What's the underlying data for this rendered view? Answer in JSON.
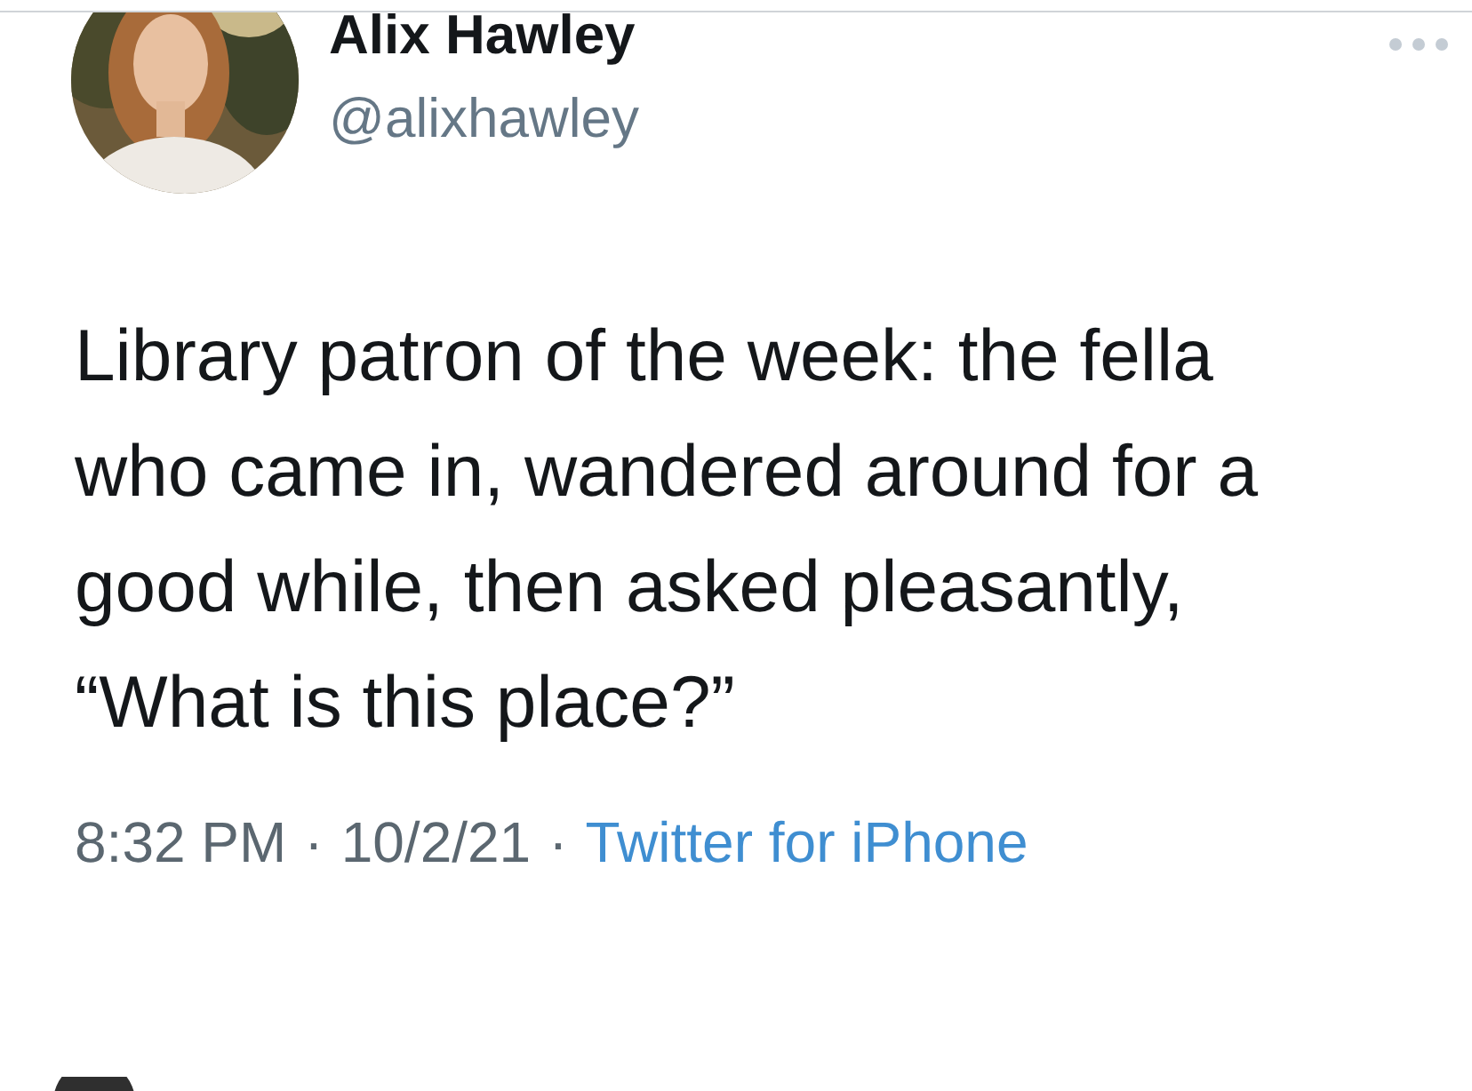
{
  "author": {
    "name": "Alix Hawley",
    "handle": "@alixhawley"
  },
  "tweet": {
    "text": "Library patron of the week: the fella who came in, wandered around for a good while, then asked pleasantly, “What is this place?”"
  },
  "meta": {
    "time": "8:32 PM",
    "separator": "·",
    "date": "10/2/21",
    "separator_2": "·",
    "source": "Twitter for iPhone"
  }
}
